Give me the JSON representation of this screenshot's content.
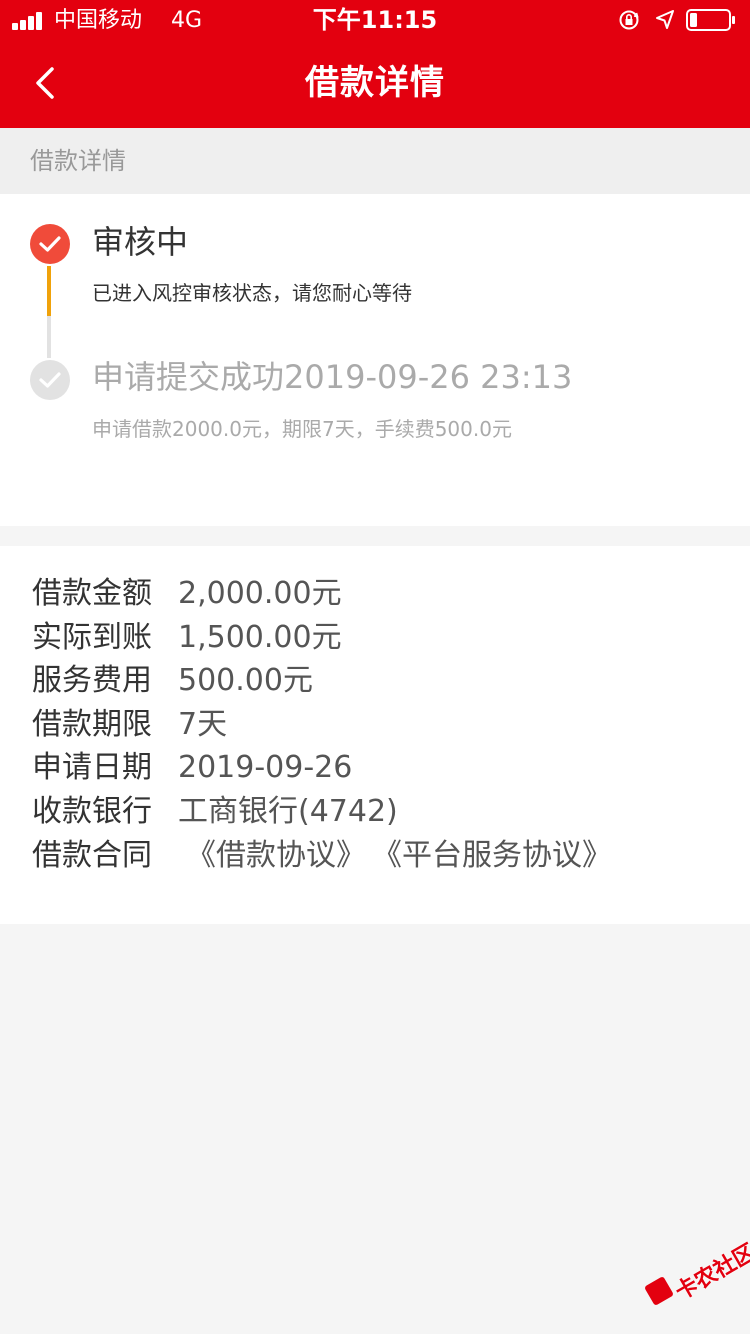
{
  "status_bar": {
    "carrier": "中国移动",
    "network": "4G",
    "time": "下午11:15"
  },
  "nav": {
    "title": "借款详情"
  },
  "section": {
    "header": "借款详情"
  },
  "timeline": {
    "current": {
      "title": "审核中",
      "desc": "已进入风控审核状态，请您耐心等待"
    },
    "previous": {
      "title": "申请提交成功2019-09-26 23:13",
      "desc": "申请借款2000.0元，期限7天，手续费500.0元"
    }
  },
  "details": {
    "loan_amount": {
      "label": "借款金额",
      "value": "2,000.00元"
    },
    "actual_received": {
      "label": "实际到账",
      "value": "1,500.00元"
    },
    "service_fee": {
      "label": "服务费用",
      "value": "500.00元"
    },
    "loan_term": {
      "label": "借款期限",
      "value": "7天"
    },
    "apply_date": {
      "label": "申请日期",
      "value": "2019-09-26"
    },
    "bank": {
      "label": "收款银行",
      "value": "工商银行(4742)"
    },
    "contract": {
      "label": "借款合同",
      "links": [
        "《借款协议》",
        "《平台服务协议》"
      ]
    }
  },
  "colors": {
    "brand_red": "#e3000f",
    "active_dot": "#f04b3a",
    "progress_orange": "#f0a20a",
    "done_gray": "#e2e2e2"
  },
  "icons": {
    "back": "chevron-left-icon",
    "signal": "signal-icon",
    "rotation_lock": "rotation-lock-icon",
    "location": "location-arrow-icon",
    "battery": "battery-icon",
    "check": "check-icon"
  },
  "watermark": {
    "text": "卡农社区"
  }
}
